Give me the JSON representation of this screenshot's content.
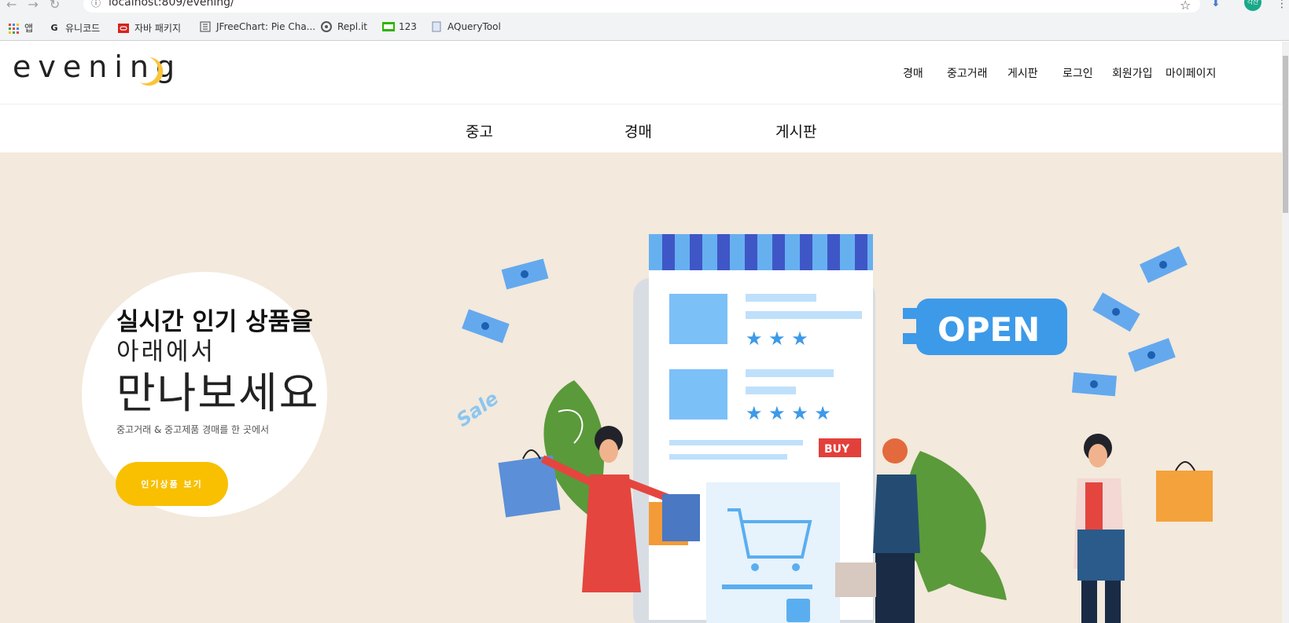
{
  "browser": {
    "url": "localhost:809/evening/",
    "avatar_text": "각산"
  },
  "bookmarks": [
    {
      "label": "앱",
      "icon": "apps-grid-icon"
    },
    {
      "label": "유니코드",
      "icon": "google-g-icon"
    },
    {
      "label": "자바 패키지",
      "icon": "oracle-icon"
    },
    {
      "label": "JFreeChart: Pie Cha...",
      "icon": "document-icon"
    },
    {
      "label": "Repl.it",
      "icon": "replit-icon"
    },
    {
      "label": "123",
      "icon": "blog-icon"
    },
    {
      "label": "AQueryTool",
      "icon": "page-icon"
    }
  ],
  "header": {
    "logo": "evening",
    "nav": [
      "경매",
      "중고거래",
      "게시판",
      "로그인",
      "회원가입",
      "마이페이지"
    ]
  },
  "categories": [
    "중고",
    "경매",
    "게시판"
  ],
  "hero": {
    "line1": "실시간 인기 상품을",
    "line2": "아래에서",
    "line3": "만나보세요",
    "sub": "중고거래 & 중고제품 경매를 한 곳에서",
    "cta": "인기상품 보기",
    "illus_open": "OPEN",
    "illus_buy": "BUY",
    "illus_sale": "Sale"
  },
  "colors": {
    "accent": "#f8c000",
    "hero_bg": "#f3e9dc"
  }
}
